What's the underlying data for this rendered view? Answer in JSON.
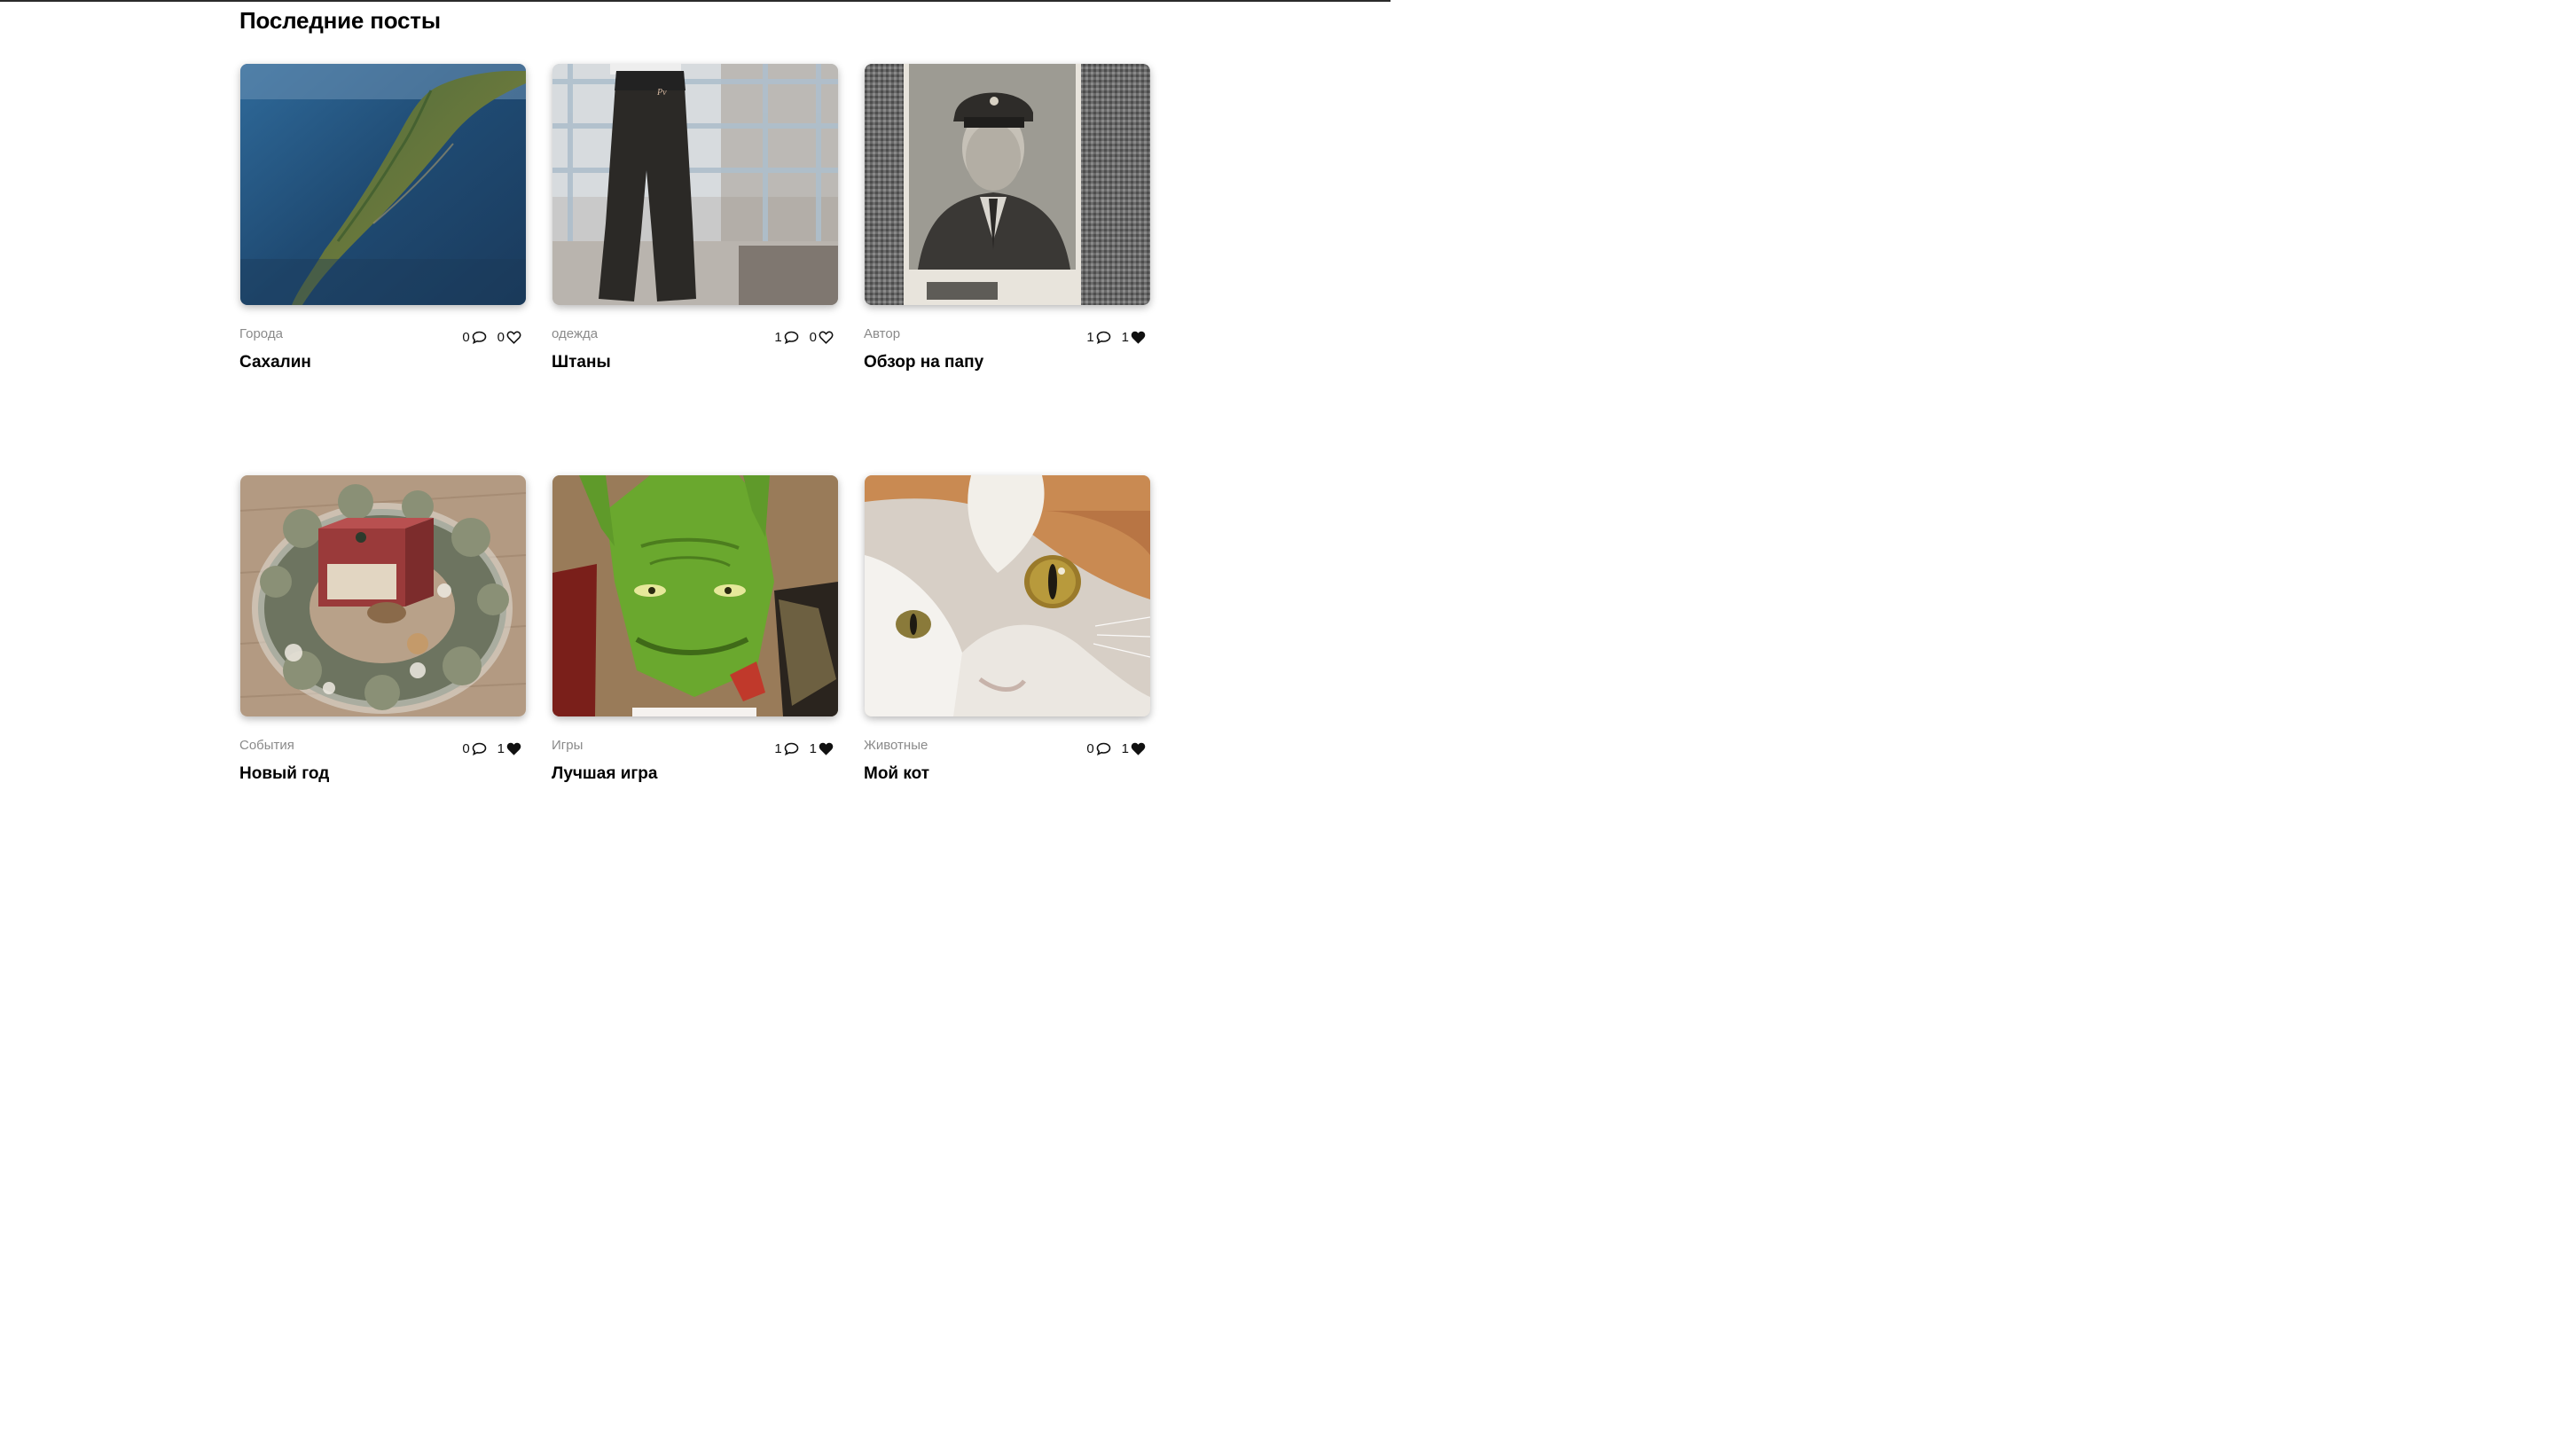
{
  "page": {
    "title": "Последние посты"
  },
  "posts": [
    {
      "category": "Города",
      "title": "Сахалин",
      "comments": "0",
      "likes": "0",
      "liked": false,
      "image": "sakhalin-aerial"
    },
    {
      "category": "одежда",
      "title": "Штаны",
      "comments": "1",
      "likes": "0",
      "liked": false,
      "image": "black-pants"
    },
    {
      "category": "Автор",
      "title": "Обзор на папу",
      "comments": "1",
      "likes": "1",
      "liked": true,
      "image": "old-portrait"
    },
    {
      "category": "События",
      "title": "Новый год",
      "comments": "0",
      "likes": "1",
      "liked": true,
      "image": "winter-wreath"
    },
    {
      "category": "Игры",
      "title": "Лучшая игра",
      "comments": "1",
      "likes": "1",
      "liked": true,
      "image": "green-orc"
    },
    {
      "category": "Животные",
      "title": "Мой кот",
      "comments": "0",
      "likes": "1",
      "liked": true,
      "image": "cat-closeup"
    }
  ],
  "icons": {
    "comment": "comment-icon",
    "like_empty": "heart-outline-icon",
    "like_filled": "heart-filled-icon"
  },
  "colors": {
    "category_text": "#8a8a8a",
    "title_text": "#000000"
  }
}
